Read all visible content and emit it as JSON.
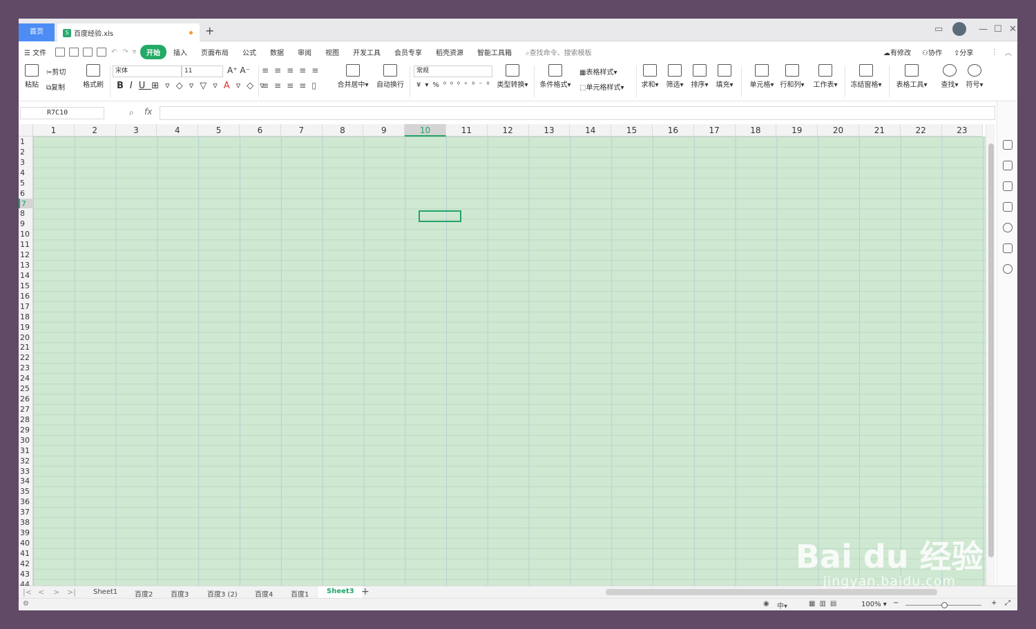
{
  "tabs": {
    "home": "首页",
    "doc": "百度经验.xls",
    "new_tab": "+"
  },
  "menu": [
    "文件",
    "开始",
    "插入",
    "页面布局",
    "公式",
    "数据",
    "审阅",
    "视图",
    "开发工具",
    "会员专享",
    "稻壳资源",
    "智能工具箱"
  ],
  "search_placeholder": "查找命令、搜索模板",
  "topright": {
    "changes": "有修改",
    "collab": "协作",
    "share": "分享"
  },
  "ribbon": {
    "paste": "粘贴",
    "cut": "剪切",
    "copy": "复制",
    "format_painter": "格式刷",
    "font": "宋体",
    "font_size": "11",
    "merge": "合并居中",
    "wrap": "自动换行",
    "number_format": "常规",
    "type_convert": "类型转换",
    "cond_format": "条件格式",
    "table_style": "表格样式",
    "cell_style": "单元格样式",
    "sum": "求和",
    "filter": "筛选",
    "sort": "排序",
    "fill": "填充",
    "cell": "单元格",
    "rowcol": "行和列",
    "worksheet": "工作表",
    "freeze": "冻结窗格",
    "table_tools": "表格工具",
    "find": "查找",
    "symbol": "符号"
  },
  "namebox": "R7C10",
  "fx_label": "fx",
  "columns": [
    "1",
    "2",
    "3",
    "4",
    "5",
    "6",
    "7",
    "8",
    "9",
    "10",
    "11",
    "12",
    "13",
    "14",
    "15",
    "16",
    "17",
    "18",
    "19",
    "20",
    "21",
    "22",
    "23"
  ],
  "selected_col": "10",
  "rows": [
    "1",
    "2",
    "3",
    "4",
    "5",
    "6",
    "7",
    "8",
    "9",
    "10",
    "11",
    "12",
    "13",
    "14",
    "15",
    "16",
    "17",
    "18",
    "19",
    "20",
    "21",
    "22",
    "23",
    "24",
    "25",
    "26",
    "27",
    "28",
    "29",
    "30",
    "31",
    "32",
    "33",
    "34",
    "35",
    "36",
    "37",
    "38",
    "39",
    "40",
    "41",
    "42",
    "43",
    "44"
  ],
  "selected_row": "7",
  "sheets": [
    "Sheet1",
    "百度2",
    "百度3",
    "百度3 (2)",
    "百度4",
    "百度1",
    "Sheet3"
  ],
  "active_sheet": "Sheet3",
  "zoom": "100%",
  "watermark": {
    "brand": "Bai du 经验",
    "url": "jingyan.baidu.com"
  },
  "colors": {
    "accent": "#21a366",
    "cell_bg": "#cfe8d1",
    "home_tab": "#4d8cf5"
  }
}
